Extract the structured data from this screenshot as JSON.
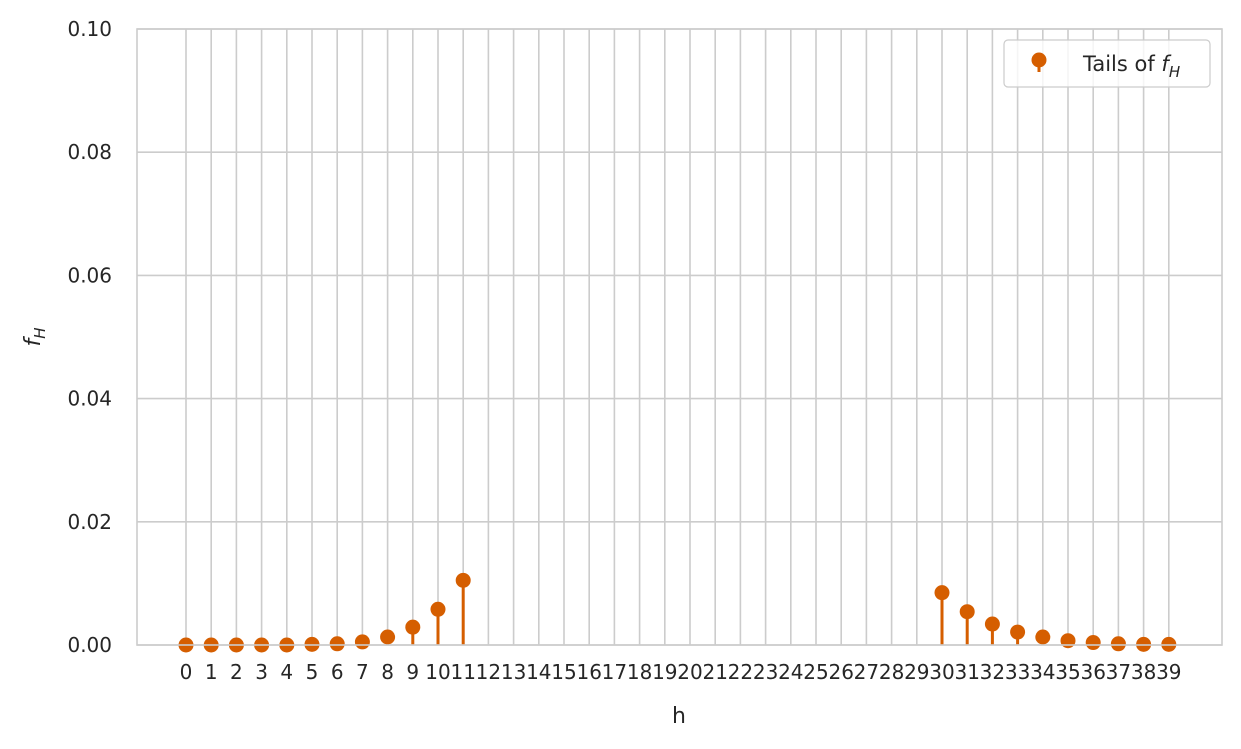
{
  "chart_data": {
    "type": "stem",
    "xlabel": "h",
    "ylabel_base": "f",
    "ylabel_sub": "H",
    "ylim": [
      0,
      0.1
    ],
    "yticks": [
      "0.00",
      "0.02",
      "0.04",
      "0.06",
      "0.08",
      "0.10"
    ],
    "x": [
      0,
      1,
      2,
      3,
      4,
      5,
      6,
      7,
      8,
      9,
      10,
      11,
      12,
      13,
      14,
      15,
      16,
      17,
      18,
      19,
      20,
      21,
      22,
      23,
      24,
      25,
      26,
      27,
      28,
      29,
      30,
      31,
      32,
      33,
      34,
      35,
      36,
      37,
      38,
      39
    ],
    "grid": true,
    "legend_position": "top-right",
    "series": [
      {
        "name_prefix": "Tails of ",
        "name_base": "f",
        "name_sub": "H",
        "color": "#D55E00",
        "points": [
          {
            "x": 0,
            "y": 0.0
          },
          {
            "x": 1,
            "y": 0.0
          },
          {
            "x": 2,
            "y": 0.0
          },
          {
            "x": 3,
            "y": 0.0
          },
          {
            "x": 4,
            "y": 0.0
          },
          {
            "x": 5,
            "y": 0.0001
          },
          {
            "x": 6,
            "y": 0.0002
          },
          {
            "x": 7,
            "y": 0.0005
          },
          {
            "x": 8,
            "y": 0.0013
          },
          {
            "x": 9,
            "y": 0.0029
          },
          {
            "x": 10,
            "y": 0.0058
          },
          {
            "x": 11,
            "y": 0.0105
          },
          {
            "x": 30,
            "y": 0.0085
          },
          {
            "x": 31,
            "y": 0.0054
          },
          {
            "x": 32,
            "y": 0.0034
          },
          {
            "x": 33,
            "y": 0.0021
          },
          {
            "x": 34,
            "y": 0.0013
          },
          {
            "x": 35,
            "y": 0.0007
          },
          {
            "x": 36,
            "y": 0.0004
          },
          {
            "x": 37,
            "y": 0.0002
          },
          {
            "x": 38,
            "y": 0.0001
          },
          {
            "x": 39,
            "y": 0.0001
          }
        ]
      }
    ]
  }
}
